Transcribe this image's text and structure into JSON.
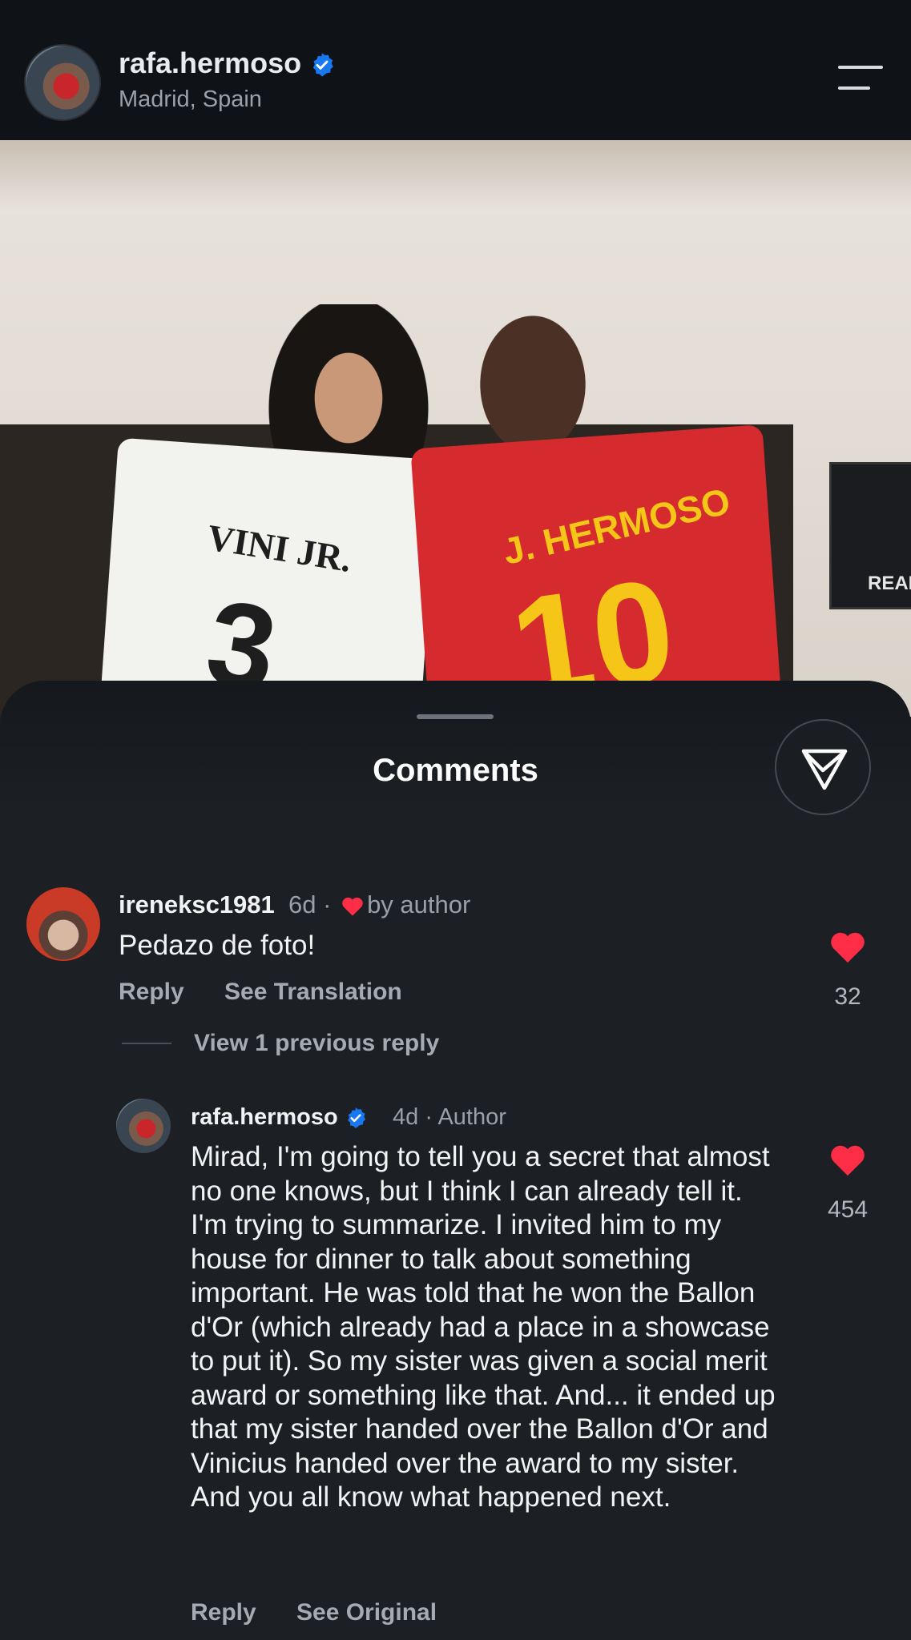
{
  "header": {
    "username": "rafa.hermoso",
    "location": "Madrid, Spain",
    "verified_color": "#1877f2"
  },
  "photo": {
    "jersey_left_name": "VINI JR.",
    "jersey_left_number": "3",
    "jersey_right_name": "J. HERMOSO",
    "jersey_right_number": "10",
    "frame_text": "REAL"
  },
  "sheet": {
    "title": "Comments",
    "share_icon": "send-icon"
  },
  "comments": [
    {
      "username": "ireneksc1981",
      "time": "6d",
      "separator": "·",
      "liked_by": "by author",
      "text": "Pedazo de foto!",
      "actions": [
        "Reply",
        "See Translation"
      ],
      "likes": "32",
      "view_replies": "View 1 previous reply"
    },
    {
      "username": "rafa.hermoso",
      "time": "4d",
      "separator": "·",
      "role": "Author",
      "text": "Mirad, I'm going to tell you a secret that almost no one knows, but I think I can already tell it. I'm trying to summarize. I invited him to my house for dinner to talk about something important. He was told that he won the Ballon d'Or (which already had a place in a showcase to put it). So my sister was given a social merit award or something like that. And... it ended up that my sister handed over the Ballon d'Or and Vinicius handed over the award to my sister. And you all know what happened next.",
      "actions": [
        "Reply",
        "See Original"
      ],
      "likes": "454"
    }
  ],
  "colors": {
    "heart": "#ff2d46",
    "background": "#1c1f24",
    "header_bg": "#0f1217"
  }
}
